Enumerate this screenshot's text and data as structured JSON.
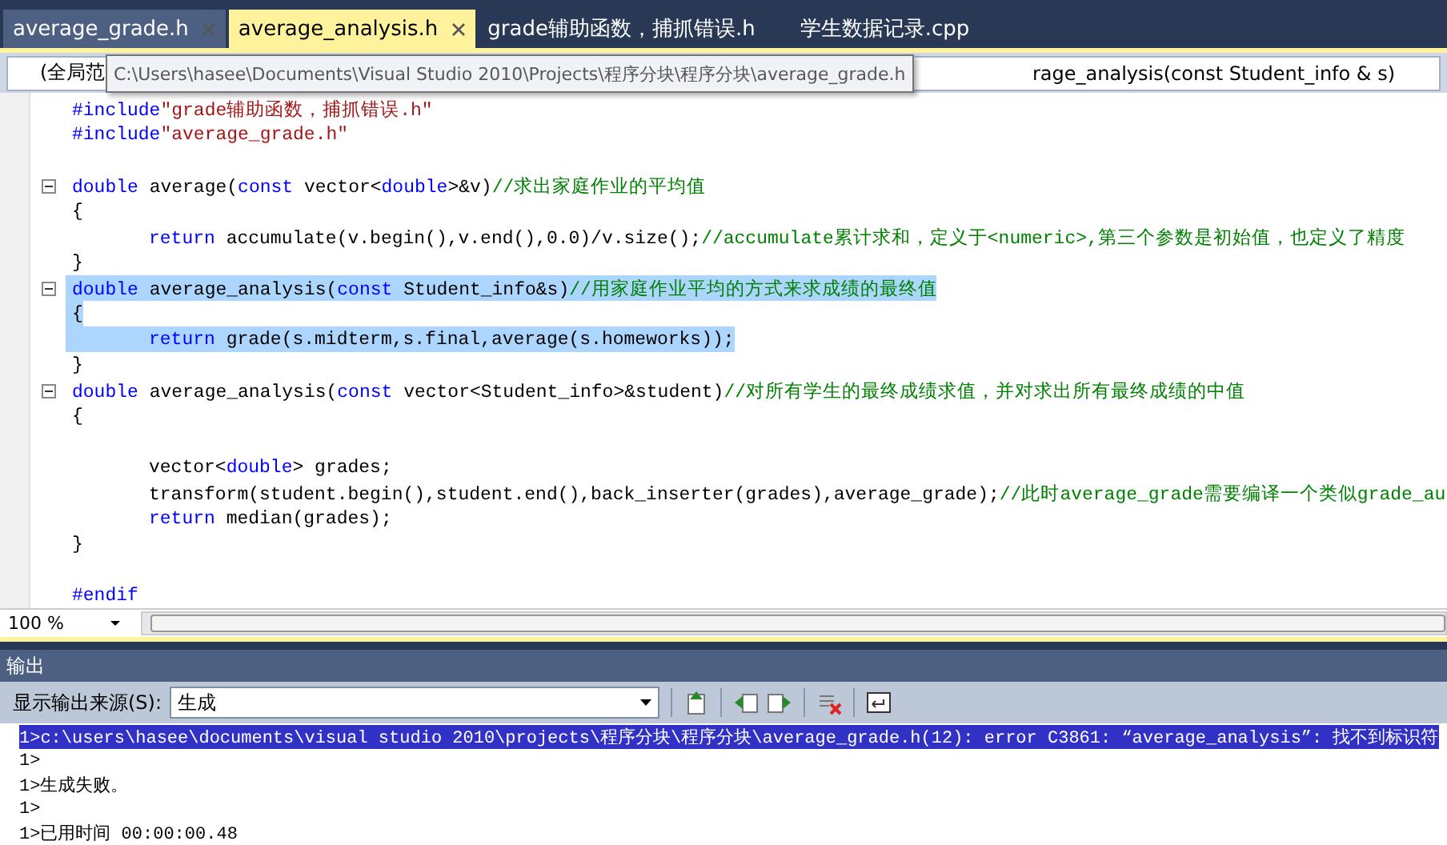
{
  "tabs": [
    {
      "label": "average_grade.h",
      "selected": false,
      "hovered": true
    },
    {
      "label": "average_analysis.h",
      "selected": true,
      "hovered": false
    },
    {
      "label": "grade辅助函数，捕抓错误.h",
      "selected": false,
      "hovered": false
    },
    {
      "label": "学生数据记录.cpp",
      "selected": false,
      "hovered": false
    }
  ],
  "nav": {
    "scope": "(全局范",
    "member": "rage_analysis(const Student_info & s)"
  },
  "tooltip": "C:\\Users\\hasee\\Documents\\Visual Studio 2010\\Projects\\程序分块\\程序分块\\average_grade.h",
  "code": [
    {
      "fold": false,
      "selected": false,
      "indented": false,
      "tokens": [
        {
          "kind": "pp",
          "text": "#include"
        },
        {
          "kind": "str",
          "text": "\"grade辅助函数，捕抓错误.h\""
        }
      ]
    },
    {
      "fold": false,
      "selected": false,
      "indented": false,
      "tokens": [
        {
          "kind": "pp",
          "text": "#include"
        },
        {
          "kind": "str",
          "text": "\"average_grade.h\""
        }
      ]
    },
    {
      "fold": false,
      "selected": false,
      "indented": false
    },
    {
      "fold": true,
      "selected": false,
      "indented": false,
      "tokens": [
        {
          "kind": "kw",
          "text": "double"
        },
        {
          "kind": "plain",
          "text": " average("
        },
        {
          "kind": "kw",
          "text": "const"
        },
        {
          "kind": "plain",
          "text": " vector<"
        },
        {
          "kind": "kw",
          "text": "double"
        },
        {
          "kind": "plain",
          "text": ">&v)"
        },
        {
          "kind": "comment",
          "text": "//求出家庭作业的平均值"
        }
      ]
    },
    {
      "fold": false,
      "selected": false,
      "indented": false,
      "tokens": [
        {
          "kind": "plain",
          "text": "{"
        }
      ]
    },
    {
      "fold": false,
      "selected": false,
      "indented": true,
      "tokens": [
        {
          "kind": "kw",
          "text": "return"
        },
        {
          "kind": "plain",
          "text": " accumulate(v.begin(),v.end(),0.0)/v.size();"
        },
        {
          "kind": "comment",
          "text": "//accumulate累计求和，定义于<numeric>,第三个参数是初始值，也定义了精度"
        }
      ]
    },
    {
      "fold": false,
      "selected": false,
      "indented": false,
      "tokens": [
        {
          "kind": "plain",
          "text": "}"
        }
      ]
    },
    {
      "fold": true,
      "selected": true,
      "indented": false,
      "tokens": [
        {
          "kind": "kw",
          "text": "double"
        },
        {
          "kind": "plain",
          "text": " average_analysis("
        },
        {
          "kind": "kw",
          "text": "const"
        },
        {
          "kind": "plain",
          "text": " Student_info&s)"
        },
        {
          "kind": "comment",
          "text": "//用家庭作业平均的方式来求成绩的最终值"
        }
      ]
    },
    {
      "fold": false,
      "selected": true,
      "indented": false,
      "tokens": [
        {
          "kind": "plain",
          "text": "{"
        }
      ]
    },
    {
      "fold": false,
      "selected": true,
      "indented": true,
      "tokens": [
        {
          "kind": "kw",
          "text": "return"
        },
        {
          "kind": "plain",
          "text": " grade(s.midterm,s.final,average(s.homeworks));"
        }
      ]
    },
    {
      "fold": false,
      "selected": false,
      "indented": false,
      "tokens": [
        {
          "kind": "plain",
          "text": "}"
        }
      ]
    },
    {
      "fold": true,
      "selected": false,
      "indented": false,
      "tokens": [
        {
          "kind": "kw",
          "text": "double"
        },
        {
          "kind": "plain",
          "text": " average_analysis("
        },
        {
          "kind": "kw",
          "text": "const"
        },
        {
          "kind": "plain",
          "text": " vector<Student_info>&student)"
        },
        {
          "kind": "comment",
          "text": "//对所有学生的最终成绩求值，并对求出所有最终成绩的中值"
        }
      ]
    },
    {
      "fold": false,
      "selected": false,
      "indented": false,
      "tokens": [
        {
          "kind": "plain",
          "text": "{"
        }
      ]
    },
    {
      "fold": false,
      "selected": false,
      "indented": false
    },
    {
      "fold": false,
      "selected": false,
      "indented": true,
      "tokens": [
        {
          "kind": "plain",
          "text": "vector<"
        },
        {
          "kind": "kw",
          "text": "double"
        },
        {
          "kind": "plain",
          "text": "> grades;"
        }
      ]
    },
    {
      "fold": false,
      "selected": false,
      "indented": true,
      "tokens": [
        {
          "kind": "plain",
          "text": "transform(student.begin(),student.end(),back_inserter(grades),average_grade);"
        },
        {
          "kind": "comment",
          "text": "//此时average_grade需要编译一个类似grade_au"
        }
      ]
    },
    {
      "fold": false,
      "selected": false,
      "indented": true,
      "tokens": [
        {
          "kind": "kw",
          "text": "return"
        },
        {
          "kind": "plain",
          "text": " median(grades);"
        }
      ]
    },
    {
      "fold": false,
      "selected": false,
      "indented": false,
      "tokens": [
        {
          "kind": "plain",
          "text": "}"
        }
      ]
    },
    {
      "fold": false,
      "selected": false,
      "indented": false
    },
    {
      "fold": false,
      "selected": false,
      "indented": false,
      "tokens": [
        {
          "kind": "pp",
          "text": "#endif"
        }
      ]
    }
  ],
  "zoom": "100 %",
  "output": {
    "title": "输出",
    "source_label": "显示输出来源(S):",
    "source_value": "生成",
    "lines": [
      {
        "text": "1>c:\\users\\hasee\\documents\\visual studio 2010\\projects\\程序分块\\程序分块\\average_grade.h(12): error C3861: “average_analysis”: 找不到标识符",
        "selected": true
      },
      {
        "text": "1>",
        "selected": false
      },
      {
        "text": "1>生成失败。",
        "selected": false
      },
      {
        "text": "1>",
        "selected": false
      },
      {
        "text": "1>已用时间 00:00:00.48",
        "selected": false
      }
    ]
  }
}
